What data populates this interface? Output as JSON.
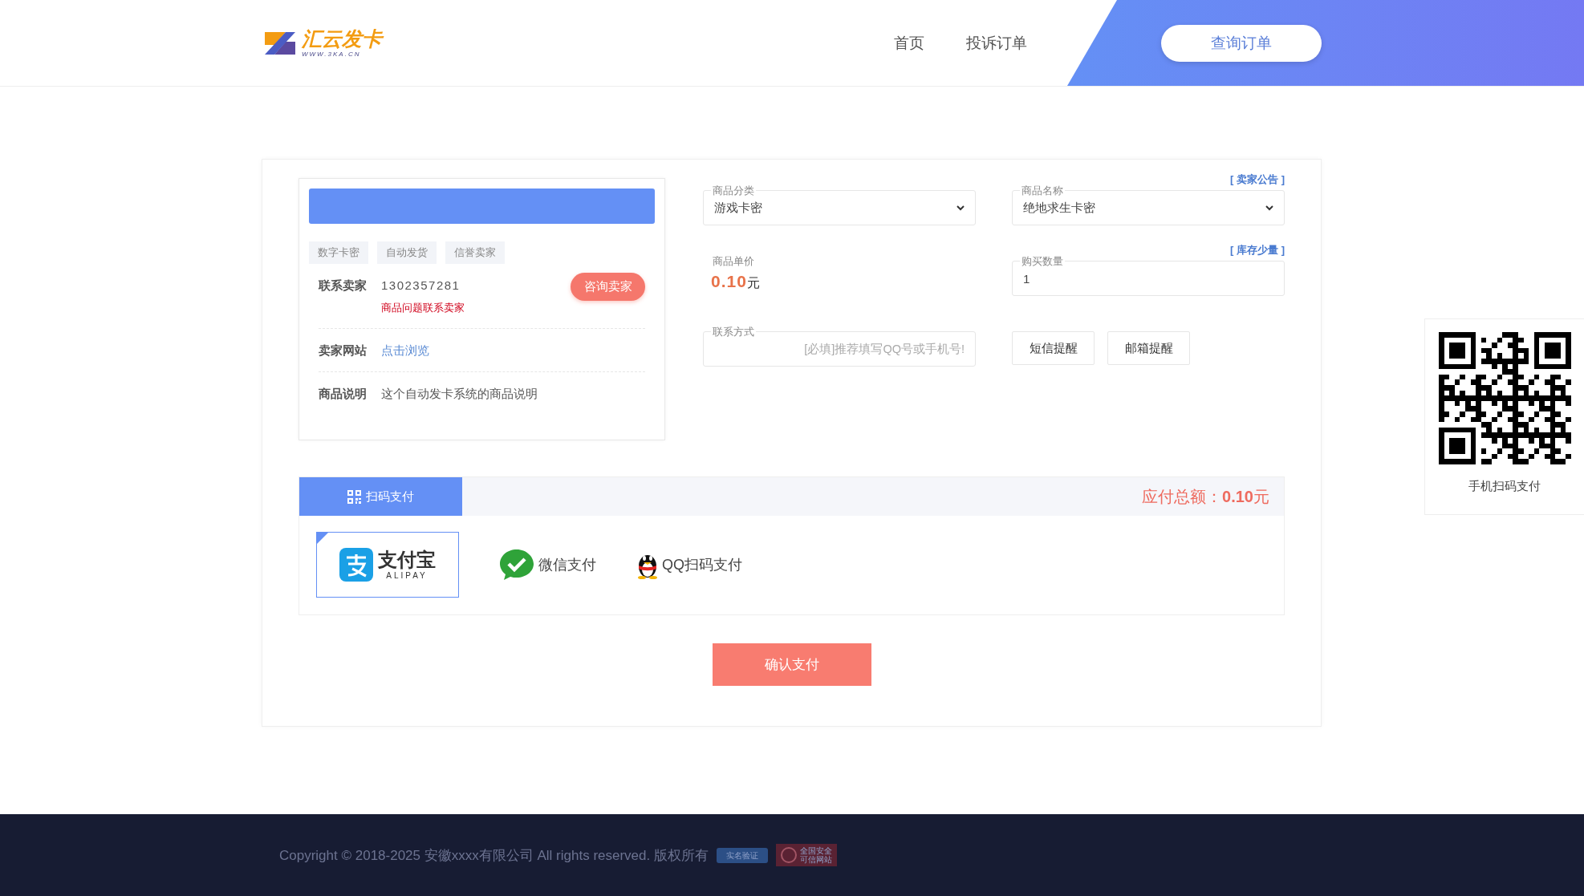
{
  "header": {
    "logo": {
      "name": "汇云发卡",
      "domain": "WWW.3KA.CN"
    },
    "nav": [
      "首页",
      "投诉订单"
    ],
    "query_button": "查询订单"
  },
  "product_card": {
    "tags": [
      "数字卡密",
      "自动发货",
      "信誉卖家"
    ],
    "contact": {
      "label": "联系卖家",
      "value": "1302357281",
      "note": "商品问题联系卖家",
      "button": "咨询卖家"
    },
    "website": {
      "label": "卖家网站",
      "link": "点击浏览"
    },
    "description": {
      "label": "商品说明",
      "value": "这个自动发卡系统的商品说明"
    }
  },
  "order_form": {
    "category": {
      "label": "商品分类",
      "value": "游戏卡密"
    },
    "product": {
      "label": "商品名称",
      "value": "绝地求生卡密",
      "link": "[ 卖家公告 ]"
    },
    "price": {
      "label": "商品单价",
      "amount": "0.10",
      "unit": "元"
    },
    "quantity": {
      "label": "购买数量",
      "value": "1",
      "link": "[ 库存少量 ]"
    },
    "contact": {
      "label": "联系方式",
      "placeholder": "[必填]推荐填写QQ号或手机号!"
    },
    "buttons": [
      "短信提醒",
      "邮箱提醒"
    ]
  },
  "payment": {
    "tab": "扫码支付",
    "total": {
      "label": "应付总额：",
      "amount": "0.10",
      "unit": "元"
    },
    "methods": [
      {
        "kind": "alipay",
        "label": "支付宝",
        "sub": "ALIPAY",
        "selected": true
      },
      {
        "kind": "wechat",
        "label": "微信支付",
        "selected": false
      },
      {
        "kind": "qq",
        "label": "QQ扫码支付",
        "selected": false
      }
    ]
  },
  "confirm_button": "确认支付",
  "qr_panel": {
    "caption": "手机扫码支付"
  },
  "footer": {
    "copyright": "Copyright © 2018-2025 安徽xxxx有限公司 All rights reserved. 版权所有",
    "badges": [
      {
        "kind": "ribbon",
        "lines": [
          "实名验证"
        ]
      },
      {
        "kind": "seal",
        "lines": [
          "全国安全",
          "可信网站"
        ]
      }
    ]
  }
}
